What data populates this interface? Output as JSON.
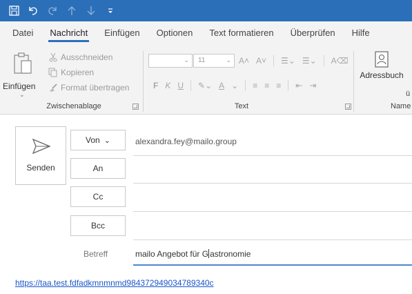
{
  "colors": {
    "titlebar": "#2b6fb9",
    "ribbon_bg": "#f3f3f3",
    "link": "#1a56c9",
    "accent": "#2b6fb9"
  },
  "quick_access": [
    {
      "name": "save-icon"
    },
    {
      "name": "undo-icon"
    },
    {
      "name": "redo-icon"
    },
    {
      "name": "arrow-up-icon"
    },
    {
      "name": "arrow-down-icon"
    },
    {
      "name": "customize-qat-icon"
    }
  ],
  "tabs": [
    "Datei",
    "Nachricht",
    "Einfügen",
    "Optionen",
    "Text formatieren",
    "Überprüfen",
    "Hilfe"
  ],
  "active_tab": "Nachricht",
  "ribbon": {
    "clipboard": {
      "paste": "Einfügen",
      "cut": "Ausschneiden",
      "copy": "Kopieren",
      "format_painter": "Format übertragen",
      "group": "Zwischenablage"
    },
    "text": {
      "font_size": "11",
      "bold": "F",
      "italic": "K",
      "underline": "U",
      "group": "Text"
    },
    "names": {
      "address_book": "Adressbuch",
      "group": "Name",
      "partial_label": "ü"
    }
  },
  "compose": {
    "send": "Senden",
    "from_label": "Von",
    "from_value": "alexandra.fey@mailo.group",
    "to_label": "An",
    "cc_label": "Cc",
    "bcc_label": "Bcc",
    "subject_label": "Betreff",
    "subject_before_cursor": "mailo Angebot für G",
    "subject_after_cursor": "astronomie",
    "body_link": "https://taa.test.fdfadkmnmnmd984372949034789340c"
  }
}
